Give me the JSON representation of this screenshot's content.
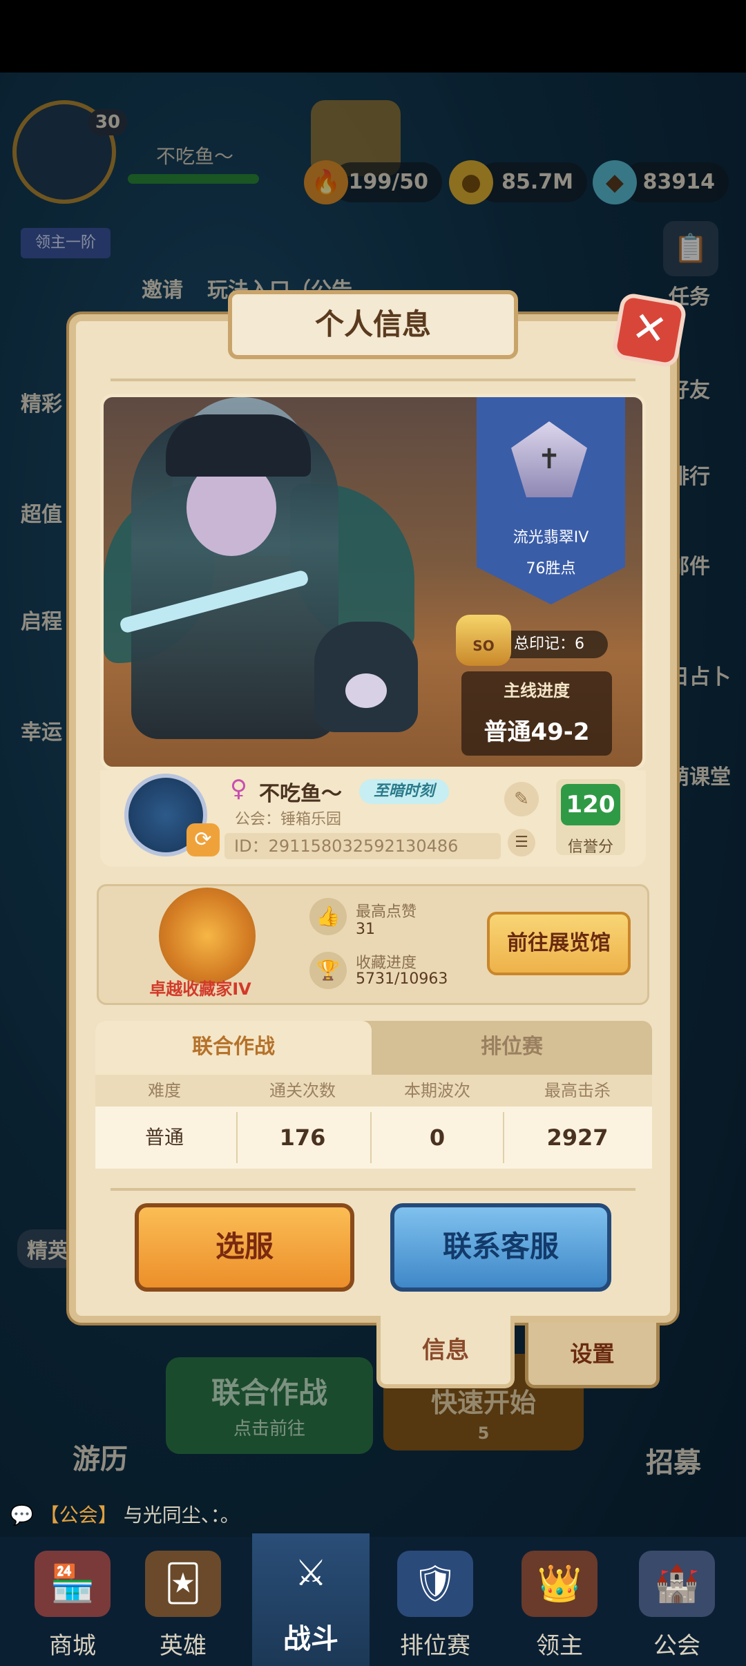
{
  "hud": {
    "level": "30",
    "player_name": "不吃鱼～",
    "rank_tag": "领主一阶",
    "stamina": "199/50",
    "gold": "85.7M",
    "gems": "83914"
  },
  "side_left": {
    "invite": "邀请",
    "play_entry": "玩法入口（公告",
    "item1": "精彩",
    "item2": "超值",
    "item3": "启程",
    "item4": "幸运",
    "elite": "精英"
  },
  "side_right": {
    "tasks": "任务",
    "friends": "好友",
    "ranking": "排行",
    "mail": "邮件",
    "divination": "日占卜",
    "classroom": "萌课堂"
  },
  "panel": {
    "title": "个人信息",
    "rank": {
      "name": "流光翡翠IV",
      "points": "76胜点"
    },
    "marks": {
      "badge": "SO",
      "label": "总印记：6"
    },
    "main_progress": {
      "title": "主线进度",
      "value": "普通49-2"
    },
    "profile": {
      "name": "不吃鱼～",
      "title_badge": "至暗时刻",
      "guild": "公会：锤箱乐园",
      "id": "ID：291158032592130486",
      "credit_value": "120",
      "credit_label": "信誉分"
    },
    "collection": {
      "trophy_label": "卓越收藏家IV",
      "likes_label": "最高点赞",
      "likes_value": "31",
      "progress_label": "收藏进度",
      "progress_value": "5731/10963",
      "gallery_button": "前往展览馆"
    },
    "tabs": {
      "active": "联合作战",
      "inactive": "排位赛"
    },
    "table": {
      "headers": [
        "难度",
        "通关次数",
        "本期波次",
        "最高击杀"
      ],
      "row": [
        "普通",
        "176",
        "0",
        "2927"
      ]
    },
    "buttons": {
      "select_server": "选服",
      "contact_support": "联系客服"
    },
    "bottom_tabs": {
      "info": "信息",
      "settings": "设置"
    }
  },
  "background": {
    "coop_title": "联合作战",
    "coop_sub": "点击前往",
    "quick_start": "快速开始",
    "quick_cost": "5",
    "travel": "游历",
    "recruit": "招募",
    "chat_channel": "【公会】",
    "chat_text": "与光同尘、：。"
  },
  "nav": {
    "items": [
      "商城",
      "英雄",
      "战斗",
      "排位赛",
      "领主",
      "公会"
    ]
  },
  "colors": {
    "panel_bg": "#efe1c2",
    "orange_button": "#ec8f2a",
    "blue_button": "#3f88c8",
    "credit_green": "#2f9a45",
    "rank_blue": "#3a5da8"
  }
}
